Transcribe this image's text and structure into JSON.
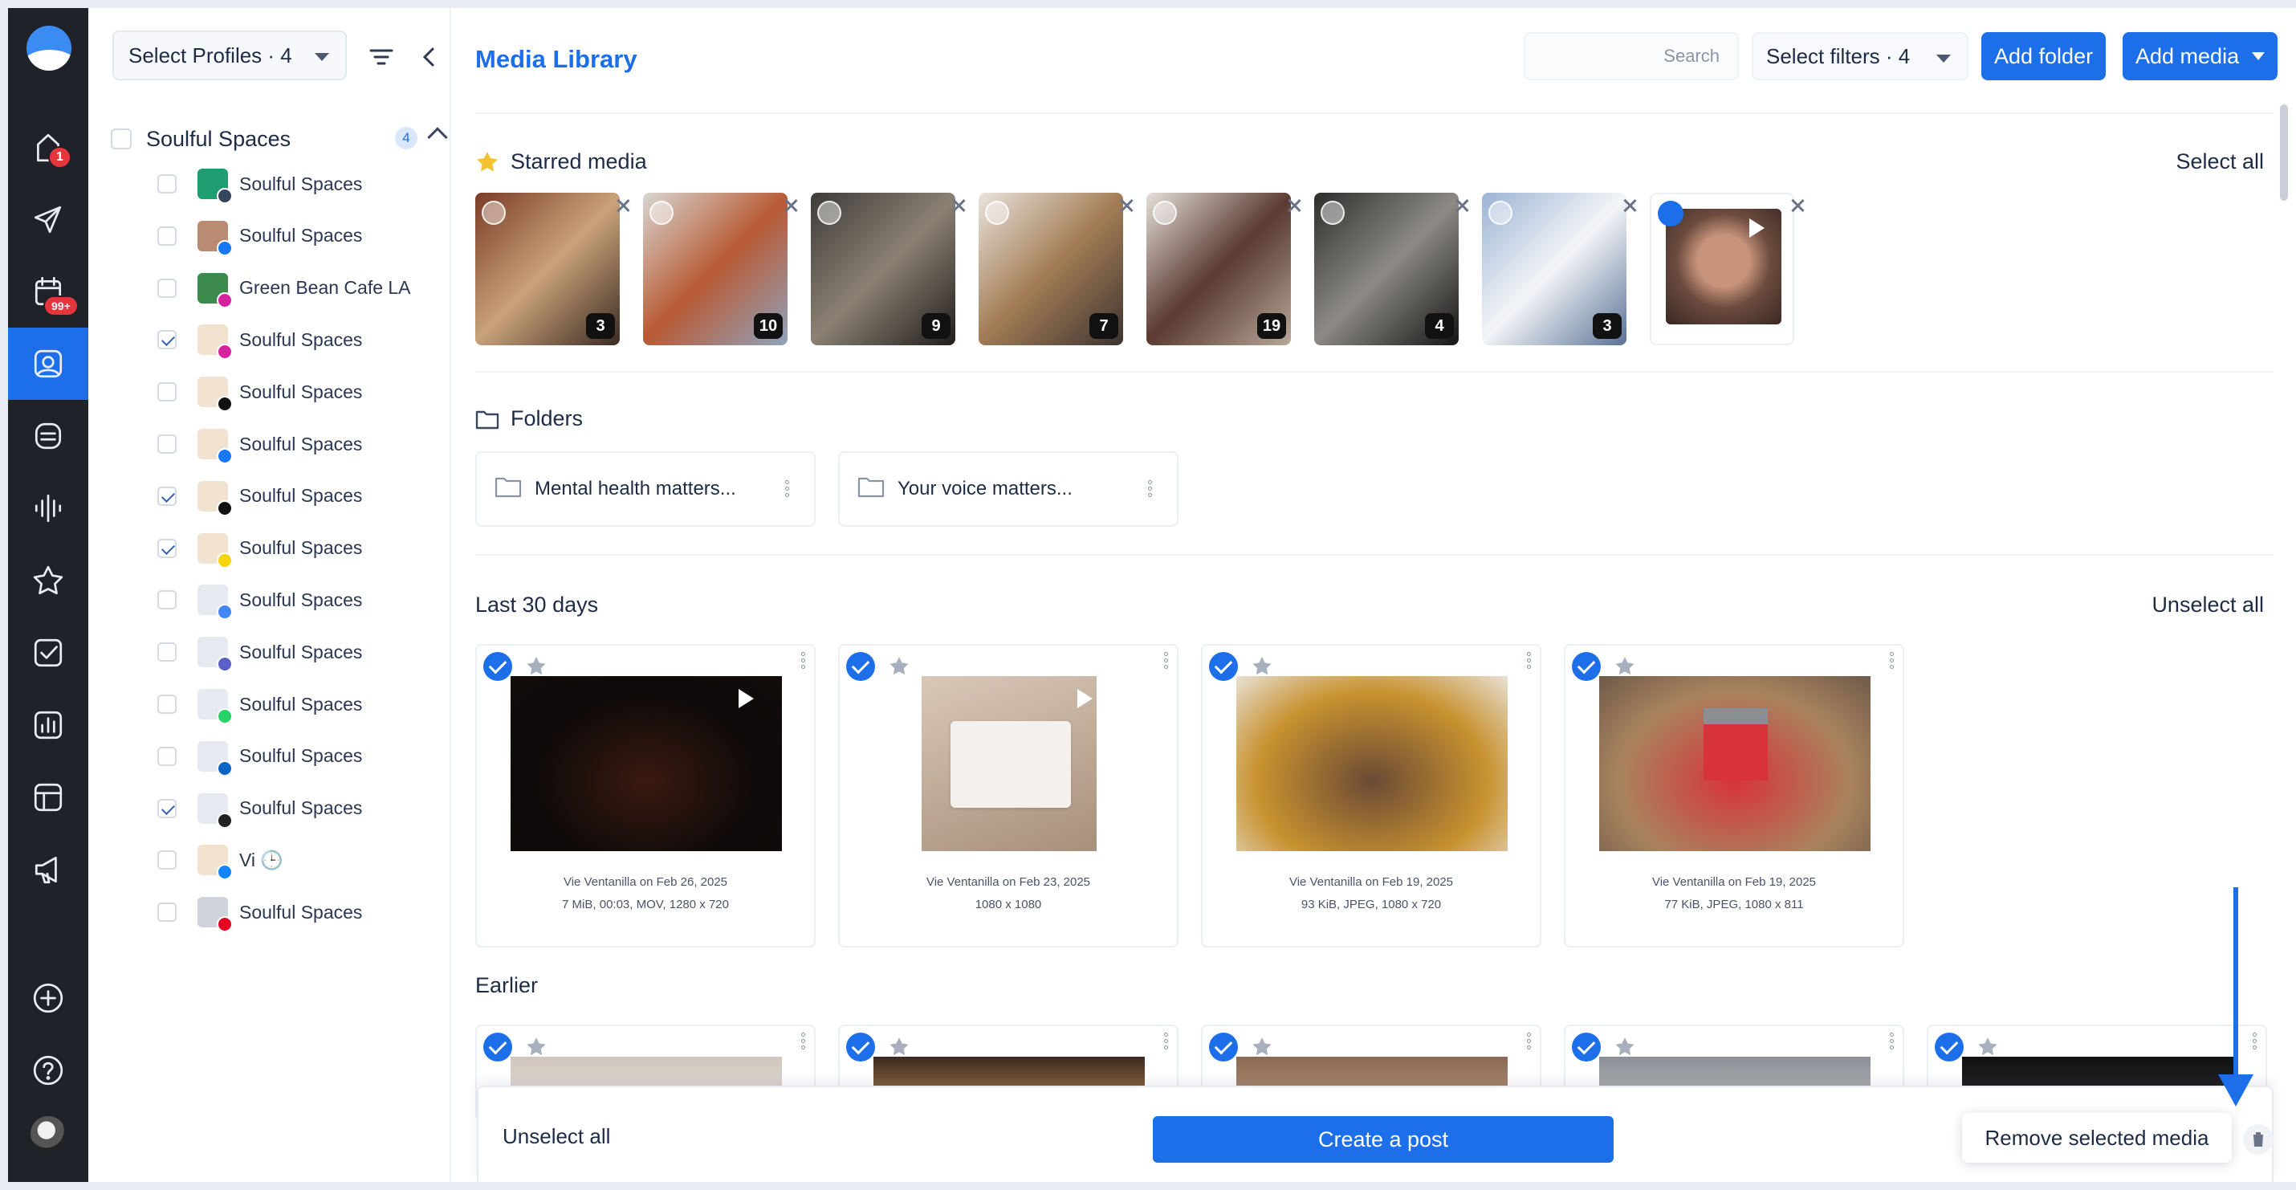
{
  "rail": {
    "badges": {
      "home": "1",
      "calendar": "99+"
    },
    "icons": [
      "home-icon",
      "send-icon",
      "calendar-icon",
      "media-icon",
      "inbox-icon",
      "listening-icon",
      "star-icon",
      "tasks-icon",
      "analytics-icon",
      "templates-icon",
      "megaphone-icon",
      "add-icon",
      "help-icon"
    ]
  },
  "sidebar": {
    "profile_select": "Select Profiles · 4",
    "group": {
      "name": "Soulful Spaces",
      "count": "4"
    },
    "accounts": [
      {
        "name": "Soulful Spaces",
        "checked": false,
        "network": "tumblr",
        "color": "#1e9e70"
      },
      {
        "name": "Soulful Spaces",
        "checked": false,
        "network": "facebook",
        "color": "#b98b72"
      },
      {
        "name": "Green Bean Cafe LA",
        "checked": false,
        "network": "instagram",
        "color": "#3c8a4d"
      },
      {
        "name": "Soulful Spaces",
        "checked": true,
        "network": "instagram",
        "color": "#f1e3cf"
      },
      {
        "name": "Soulful Spaces",
        "checked": false,
        "network": "x",
        "color": "#f1e3cf"
      },
      {
        "name": "Soulful Spaces",
        "checked": false,
        "network": "facebook",
        "color": "#f1e3cf"
      },
      {
        "name": "Soulful Spaces",
        "checked": true,
        "network": "tiktok",
        "color": "#f1e3cf"
      },
      {
        "name": "Soulful Spaces",
        "checked": true,
        "network": "snapchat",
        "color": "#f1e3cf"
      },
      {
        "name": "Soulful Spaces",
        "checked": false,
        "network": "google-business",
        "color": "#e6e9f0"
      },
      {
        "name": "Soulful Spaces",
        "checked": false,
        "network": "teams",
        "color": "#e6e9f0",
        "warning": true
      },
      {
        "name": "Soulful Spaces",
        "checked": false,
        "network": "whatsapp",
        "color": "#e6e9f0"
      },
      {
        "name": "Soulful Spaces",
        "checked": false,
        "network": "linkedin",
        "color": "#e6e9f0"
      },
      {
        "name": "Soulful Spaces",
        "checked": true,
        "network": "threads",
        "color": "#e6e9f0"
      },
      {
        "name": "Vi 🕒",
        "checked": false,
        "network": "bluesky",
        "color": "#f1e3cf"
      },
      {
        "name": "Soulful Spaces",
        "checked": false,
        "network": "pinterest",
        "color": "#cfd4dc"
      }
    ]
  },
  "header": {
    "title": "Media Library",
    "search_placeholder": "Search",
    "filters": "Select filters · 4",
    "add_folder": "Add folder",
    "add_media": "Add media"
  },
  "starred": {
    "title": "Starred media",
    "action": "Select all",
    "items": [
      {
        "count": "3",
        "colors": [
          "#7a3b25",
          "#c9a27a",
          "#3b2a22"
        ]
      },
      {
        "count": "10",
        "colors": [
          "#d8d6d2",
          "#b95a34",
          "#8fa3bd"
        ]
      },
      {
        "count": "9",
        "colors": [
          "#3d3b39",
          "#8b8173",
          "#201d1b"
        ]
      },
      {
        "count": "7",
        "colors": [
          "#e9e4dd",
          "#a27c55",
          "#3d3431"
        ]
      },
      {
        "count": "19",
        "colors": [
          "#e5e0da",
          "#5a3a30",
          "#b8a799"
        ]
      },
      {
        "count": "4",
        "colors": [
          "#2c2e2c",
          "#8d8a84",
          "#151515"
        ]
      },
      {
        "count": "3",
        "colors": [
          "#9cb4d4",
          "#f3f5f7",
          "#5a7296"
        ]
      },
      {
        "count": "",
        "colors": [
          "#6b4b3e",
          "#c8937b",
          "#3a2823"
        ],
        "selected": true,
        "video": true
      }
    ]
  },
  "folders": {
    "title": "Folders",
    "items": [
      "Mental health matters...",
      "Your voice matters..."
    ]
  },
  "last30": {
    "title": "Last 30 days",
    "action": "Unselect all",
    "items": [
      {
        "meta1": "Vie Ventanilla on Feb 26, 2025",
        "meta2": "7 MiB, 00:03, MOV, 1280 x 720",
        "video": true,
        "colors": [
          "#0d0a09",
          "#3a1a10",
          "#120c0a"
        ]
      },
      {
        "meta1": "Vie Ventanilla on Feb 23, 2025",
        "meta2": "1080 x 1080",
        "video": true,
        "colors": [
          "#d9c8b8",
          "#f4f1ed",
          "#a88f7a"
        ]
      },
      {
        "meta1": "Vie Ventanilla on Feb 19, 2025",
        "meta2": "93 KiB, JPEG, 1080 x 720",
        "video": false,
        "colors": [
          "#c8922f",
          "#6b4a36",
          "#e8e1d6"
        ]
      },
      {
        "meta1": "Vie Ventanilla on Feb 19, 2025",
        "meta2": "77 KiB, JPEG, 1080 x 811",
        "video": false,
        "colors": [
          "#a9835e",
          "#d8333a",
          "#6d5a4a"
        ]
      }
    ]
  },
  "earlier": {
    "title": "Earlier",
    "items": [
      {
        "colors": [
          "#cfc6bd",
          "#eee8e2"
        ]
      },
      {
        "colors": [
          "#3a2a20",
          "#d09a5a"
        ]
      },
      {
        "colors": [
          "#8a6a55",
          "#c7a38a"
        ]
      },
      {
        "colors": [
          "#8b8f96",
          "#c9c7c4"
        ]
      },
      {
        "colors": [
          "#111111",
          "#333333"
        ]
      }
    ]
  },
  "bottom_bar": {
    "unselect": "Unselect all",
    "create_post": "Create a post",
    "tooltip": "Remove selected media"
  },
  "colors": {
    "accent": "#1c6fe8",
    "rail": "#1f2229",
    "danger": "#e5353d"
  }
}
